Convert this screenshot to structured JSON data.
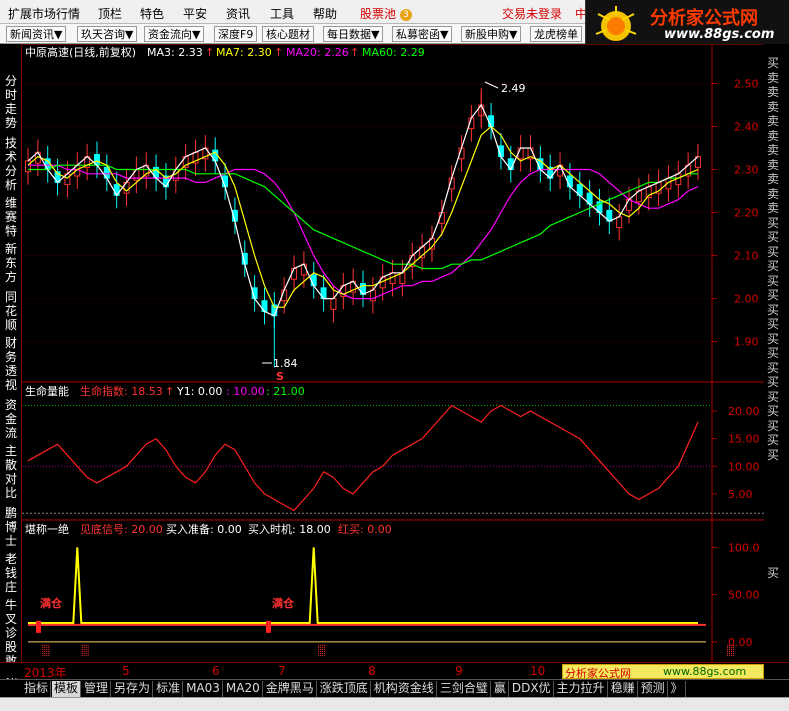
{
  "menu": {
    "items": [
      "扩展市场行情",
      "顶栏",
      "特色",
      "平安",
      "资讯",
      "工具",
      "帮助"
    ],
    "pool_label": "股票池",
    "pool_badge": "3",
    "login_status": "交易未登录",
    "login_suffix": "中"
  },
  "toolbar": {
    "buttons": [
      "新闻资讯▼",
      "玖天咨询▼",
      "资金流向▼",
      "深度F9",
      "核心题材",
      "每日数据▼",
      "私募密函▼",
      "新股申购▼",
      "龙虎榜单"
    ]
  },
  "logo": {
    "title": "分析家公式网",
    "url": "www.88gs.com"
  },
  "left_tabs": [
    "分时走势",
    "技术分析",
    "维赛特",
    "新东方",
    "同花顺",
    "财务透视",
    "资金流",
    "主散对比",
    "鹏博士",
    "老钱庄",
    "牛叉诊股",
    "敢死队"
  ],
  "right_labels": [
    "买",
    "卖",
    "卖",
    "卖",
    "卖",
    "卖",
    "卖",
    "卖",
    "卖",
    "卖",
    "卖",
    "买",
    "买",
    "买",
    "买",
    "买",
    "买",
    "买",
    "买",
    "买",
    "买",
    "买",
    "买",
    "买",
    "买",
    "买",
    "买",
    "买"
  ],
  "right_label_bottom": "买",
  "main": {
    "stock": "中原高速(日线,前复权)",
    "ma3": "MA3: 2.33",
    "ma7": "MA7: 2.30",
    "ma20": "MA20: 2.26",
    "ma60": "MA60: 2.29",
    "high_mark": "2.49",
    "low_mark": "1.84",
    "s_mark": "S",
    "yticks": [
      "2.50",
      "2.40",
      "2.30",
      "2.20",
      "2.10",
      "2.00",
      "1.90"
    ],
    "colors": {
      "ma3": "#ffffff",
      "ma7": "#ffff00",
      "ma20": "#ff00ff",
      "ma60": "#00ff00",
      "up": "#ff3232",
      "down": "#00ffff"
    }
  },
  "sub1": {
    "name": "生命量能",
    "index_label": "生命指数: 18.53",
    "y1": "Y1: 0.00",
    "v10": ": 10.00",
    "v21": ": 21.00",
    "yticks": [
      "20.00",
      "15.00",
      "10.00",
      "5.00"
    ]
  },
  "sub2": {
    "name": "堪称一绝",
    "signal": "见底信号: 20.00",
    "prepare": "买入准备: 0.00",
    "timing": "买入时机: 18.00",
    "redbuy": "红买: 0.00",
    "yticks": [
      "100.0",
      "50.00",
      "0.00"
    ],
    "fill_labels": [
      "满仓",
      "满仓"
    ]
  },
  "dates": [
    "2013年",
    "5",
    "6",
    "7",
    "8",
    "9",
    "10"
  ],
  "ad": {
    "left": "分析家公式网",
    "right": "www.88gs.com"
  },
  "bottom_tabs": [
    "指标",
    "模板",
    "管理",
    "另存为",
    "标准",
    "MA03",
    "MA20",
    "金牌黑马",
    "涨跌顶底",
    "机构资金线",
    "三剑合璧",
    "赢",
    "DDX优",
    "主力拉升",
    "稳赚",
    "预测",
    "》"
  ],
  "bottom_tabs_active": "模板",
  "chart_data": {
    "type": "line",
    "price_panel": {
      "yrange": [
        1.82,
        2.55
      ],
      "high": 2.49,
      "low": 1.84,
      "series": [
        {
          "name": "MA20",
          "values": [
            2.31,
            2.31,
            2.31,
            2.31,
            2.3,
            2.3,
            2.29,
            2.29,
            2.29,
            2.29,
            2.28,
            2.28,
            2.28,
            2.28,
            2.28,
            2.28,
            2.28,
            2.27,
            2.27,
            2.28,
            2.29,
            2.3,
            2.3,
            2.3,
            2.29,
            2.27,
            2.24,
            2.2,
            2.15,
            2.1,
            2.06,
            2.03,
            2.01,
            2.0,
            2.0,
            2.0,
            2.01,
            2.02,
            2.03,
            2.03,
            2.04,
            2.04,
            2.05,
            2.06,
            2.08,
            2.1,
            2.13,
            2.16,
            2.2,
            2.24,
            2.27,
            2.29,
            2.3,
            2.3,
            2.3,
            2.3,
            2.3,
            2.3,
            2.29,
            2.27,
            2.25,
            2.23,
            2.22,
            2.21,
            2.21,
            2.22,
            2.23,
            2.25,
            2.26
          ]
        },
        {
          "name": "MA60",
          "values": [
            2.3,
            2.3,
            2.3,
            2.31,
            2.31,
            2.31,
            2.31,
            2.31,
            2.31,
            2.3,
            2.3,
            2.3,
            2.3,
            2.3,
            2.3,
            2.3,
            2.3,
            2.29,
            2.29,
            2.29,
            2.29,
            2.29,
            2.28,
            2.27,
            2.26,
            2.24,
            2.22,
            2.2,
            2.18,
            2.16,
            2.15,
            2.14,
            2.13,
            2.12,
            2.11,
            2.1,
            2.09,
            2.08,
            2.08,
            2.08,
            2.07,
            2.07,
            2.07,
            2.08,
            2.08,
            2.09,
            2.09,
            2.1,
            2.11,
            2.12,
            2.13,
            2.14,
            2.15,
            2.17,
            2.18,
            2.19,
            2.2,
            2.21,
            2.22,
            2.23,
            2.24,
            2.25,
            2.26,
            2.27,
            2.27,
            2.28,
            2.28,
            2.29,
            2.29
          ]
        },
        {
          "name": "MA7",
          "values": [
            2.31,
            2.33,
            2.32,
            2.29,
            2.28,
            2.3,
            2.31,
            2.32,
            2.31,
            2.27,
            2.25,
            2.27,
            2.29,
            2.3,
            2.28,
            2.29,
            2.31,
            2.32,
            2.33,
            2.34,
            2.31,
            2.26,
            2.18,
            2.1,
            2.03,
            1.98,
            1.98,
            2.02,
            2.04,
            2.06,
            2.05,
            2.02,
            2.01,
            2.02,
            2.03,
            2.03,
            2.04,
            2.05,
            2.06,
            2.08,
            2.1,
            2.12,
            2.15,
            2.2,
            2.26,
            2.32,
            2.38,
            2.4,
            2.38,
            2.34,
            2.32,
            2.33,
            2.32,
            2.3,
            2.31,
            2.29,
            2.27,
            2.25,
            2.23,
            2.22,
            2.2,
            2.19,
            2.21,
            2.24,
            2.25,
            2.27,
            2.28,
            2.29,
            2.3
          ]
        },
        {
          "name": "MA3",
          "values": [
            2.32,
            2.34,
            2.3,
            2.27,
            2.29,
            2.31,
            2.33,
            2.31,
            2.28,
            2.24,
            2.27,
            2.3,
            2.31,
            2.28,
            2.26,
            2.3,
            2.33,
            2.34,
            2.35,
            2.32,
            2.26,
            2.18,
            2.08,
            2.0,
            1.97,
            1.96,
            2.02,
            2.07,
            2.08,
            2.03,
            2.0,
            2.0,
            2.03,
            2.04,
            2.01,
            2.02,
            2.05,
            2.06,
            2.06,
            2.1,
            2.12,
            2.14,
            2.2,
            2.28,
            2.35,
            2.42,
            2.45,
            2.4,
            2.33,
            2.3,
            2.35,
            2.35,
            2.3,
            2.28,
            2.31,
            2.26,
            2.24,
            2.22,
            2.2,
            2.18,
            2.19,
            2.23,
            2.25,
            2.26,
            2.27,
            2.28,
            2.29,
            2.31,
            2.33
          ]
        }
      ]
    },
    "sub1_panel": {
      "yrange": [
        1,
        22
      ],
      "series": [
        {
          "name": "生命指数",
          "values": [
            11,
            12,
            13,
            14,
            12,
            10,
            8,
            7,
            8,
            9,
            10,
            12,
            14,
            15,
            13,
            10,
            8,
            7,
            9,
            12,
            14,
            13,
            10,
            7,
            5,
            4,
            3,
            2,
            4,
            6,
            9,
            8,
            6,
            5,
            7,
            9,
            10,
            12,
            13,
            14,
            15,
            17,
            19,
            21,
            20,
            19,
            18,
            20,
            21,
            20,
            19,
            20,
            19,
            18,
            17,
            16,
            15,
            13,
            11,
            9,
            7,
            5,
            4,
            5,
            6,
            8,
            10,
            14,
            18
          ]
        }
      ],
      "reference_lines": [
        0,
        10,
        21
      ]
    },
    "sub2_panel": {
      "yrange": [
        -15,
        110
      ],
      "series": [
        {
          "name": "见底信号",
          "baseline": 20,
          "spikes_at": [
            5,
            29,
            71,
            76
          ],
          "spike_value": 100
        },
        {
          "name": "买入时机",
          "baseline": 18
        },
        {
          "name": "买入准备",
          "baseline": 0
        }
      ]
    }
  }
}
